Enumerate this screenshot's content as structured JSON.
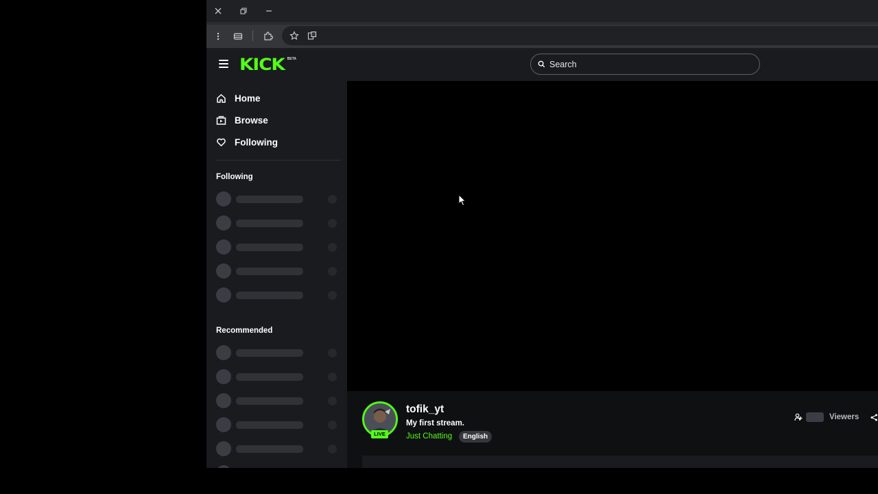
{
  "browser": {
    "window_controls": [
      {
        "icon": "close-icon"
      },
      {
        "icon": "restore-icon"
      },
      {
        "icon": "minimize-icon"
      }
    ],
    "toolbar_icons": [
      "menu-dots-icon",
      "tab-icon",
      "extensions-icon",
      "bookmark-star-icon",
      "translate-icon"
    ]
  },
  "header": {
    "logo": "KICK",
    "logo_badge": "BETA",
    "search_placeholder": "Search"
  },
  "sidebar": {
    "nav": [
      {
        "label": "Home",
        "icon": "home-icon"
      },
      {
        "label": "Browse",
        "icon": "browse-icon"
      },
      {
        "label": "Following",
        "icon": "heart-icon"
      }
    ],
    "following_title": "Following",
    "recommended_title": "Recommended"
  },
  "stream": {
    "streamer": "tofik_yt",
    "title": "My first stream.",
    "category": "Just Chatting",
    "language": "English",
    "live_badge": "LIVE",
    "viewers_label": "Viewers"
  },
  "colors": {
    "accent": "#53fc18",
    "surface": "#191b1f",
    "background": "#000000"
  }
}
